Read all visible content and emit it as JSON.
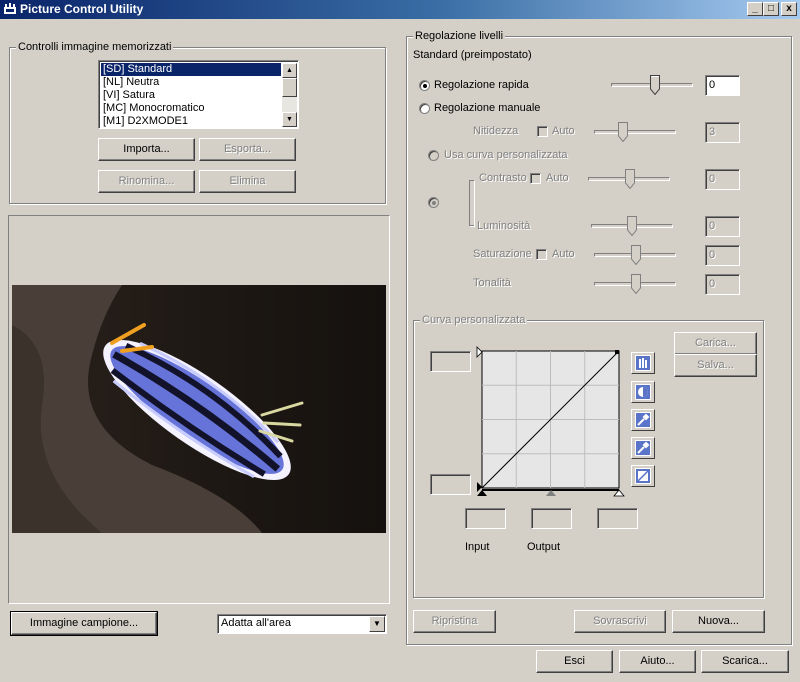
{
  "window": {
    "title": "Picture Control Utility",
    "min": "_",
    "max": "□",
    "close": "x"
  },
  "stored": {
    "title": "Controlli immagine memorizzati",
    "items": [
      "[SD] Standard",
      "[NL] Neutra",
      "[VI] Satura",
      "[MC] Monocromatico",
      "[M1] D2XMODE1"
    ],
    "import": "Importa...",
    "export": "Esporta...",
    "rename": "Rinomina...",
    "delete": "Elimina"
  },
  "preview": {
    "sample_button": "Immagine campione...",
    "fit_value": "Adatta all'area"
  },
  "levels": {
    "title": "Regolazione livelli",
    "subtitle": "Standard (preimpostato)",
    "quick_label": "Regolazione rapida",
    "quick_value": "0",
    "manual_label": "Regolazione manuale",
    "sharpness_label": "Nitidezza",
    "auto": "Auto",
    "sharpness_value": "3",
    "use_curve_label": "Usa curva personalizzata",
    "contrast_label": "Contrasto",
    "contrast_value": "0",
    "brightness_label": "Luminosità",
    "brightness_value": "0",
    "saturation_label": "Saturazione",
    "saturation_value": "0",
    "hue_label": "Tonalità",
    "hue_value": "0"
  },
  "curve": {
    "title": "Curva personalizzata",
    "load": "Carica...",
    "save": "Salva...",
    "input_label": "Input",
    "output_label": "Output"
  },
  "actions": {
    "reset": "Ripristina",
    "overwrite": "Sovrascrivi",
    "new": "Nuova...",
    "exit": "Esci",
    "help": "Aiuto...",
    "download": "Scarica..."
  },
  "colors": {
    "titlebar": "#0a246a",
    "face": "#d4d0c8",
    "selection": "#0a246a"
  }
}
